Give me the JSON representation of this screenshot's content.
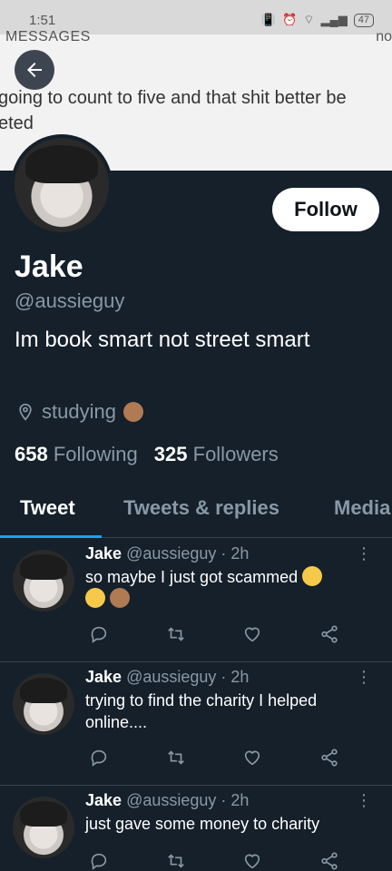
{
  "status": {
    "time": "1:51",
    "battery": "47"
  },
  "banner": {
    "messages_label": "MESSAGES",
    "right_label": "no",
    "line1": "going to count to five and that shit better be",
    "line2": "eted"
  },
  "profile": {
    "name": "Jake",
    "handle": "@aussieguy",
    "bio": "Im book smart not street smart",
    "location": "studying",
    "following_count": "658",
    "following_label": "Following",
    "followers_count": "325",
    "followers_label": "Followers",
    "follow_button": "Follow"
  },
  "tabs": [
    {
      "label": "Tweet",
      "active": true
    },
    {
      "label": "Tweets & replies",
      "active": false
    },
    {
      "label": "Media",
      "active": false
    }
  ],
  "tweets": [
    {
      "name": "Jake",
      "handle": "@aussieguy",
      "time": "2h",
      "text": "so maybe I just got scammed"
    },
    {
      "name": "Jake",
      "handle": "@aussieguy",
      "time": "2h",
      "text": "trying to find the charity I helped online...."
    },
    {
      "name": "Jake",
      "handle": "@aussieguy",
      "time": "2h",
      "text": "just gave some money to charity"
    }
  ],
  "icons": [
    "back-arrow-icon",
    "location-pin-icon",
    "shrug-emoji-icon",
    "sweat-smile-emoji-icon",
    "rofl-emoji-icon",
    "reply-icon",
    "retweet-icon",
    "like-icon",
    "share-icon",
    "more-vertical-icon"
  ],
  "colors": {
    "background": "#15202b",
    "accent": "#1da1f2",
    "muted": "#8899a6",
    "divider": "#38444d"
  }
}
